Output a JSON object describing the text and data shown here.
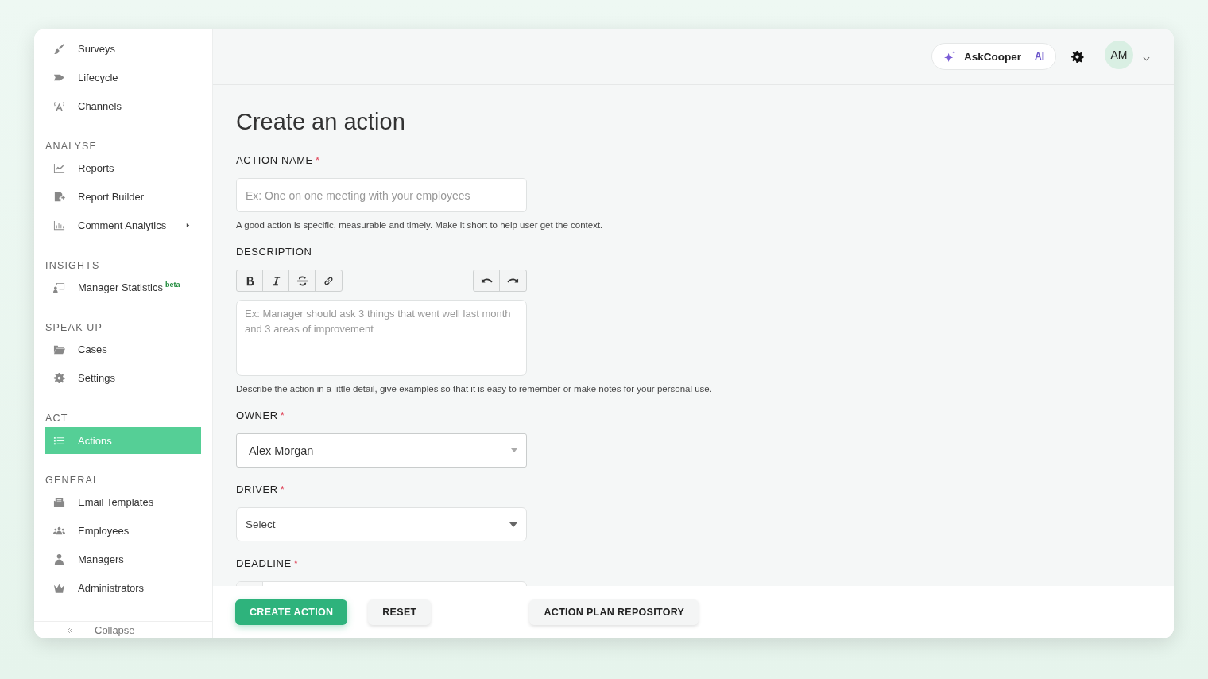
{
  "sidebar": {
    "groups": [
      {
        "items": [
          {
            "label": "Surveys",
            "selected": false
          },
          {
            "label": "Lifecycle",
            "selected": false
          },
          {
            "label": "Channels",
            "selected": false
          }
        ]
      },
      {
        "heading": "ANALYSE",
        "items": [
          {
            "label": "Reports",
            "selected": false
          },
          {
            "label": "Report Builder",
            "selected": false
          },
          {
            "label": "Comment Analytics",
            "selected": false,
            "submenu": true
          }
        ]
      },
      {
        "heading": "INSIGHTS",
        "items": [
          {
            "label": "Manager Statistics",
            "selected": false,
            "badge": "beta"
          }
        ]
      },
      {
        "heading": "SPEAK UP",
        "items": [
          {
            "label": "Cases",
            "selected": false
          },
          {
            "label": "Settings",
            "selected": false
          }
        ]
      },
      {
        "heading": "ACT",
        "items": [
          {
            "label": "Actions",
            "selected": true
          }
        ]
      },
      {
        "heading": "GENERAL",
        "items": [
          {
            "label": "Email Templates",
            "selected": false
          },
          {
            "label": "Employees",
            "selected": false
          },
          {
            "label": "Managers",
            "selected": false
          },
          {
            "label": "Administrators",
            "selected": false
          }
        ]
      }
    ],
    "collapse": "Collapse"
  },
  "header": {
    "assistant": {
      "label": "AskCooper",
      "tag": "AI"
    },
    "avatar": "AM"
  },
  "form": {
    "title": "Create an action",
    "fields": [
      {
        "kind": "text",
        "label": "ACTION NAME",
        "marker": "*",
        "placeholder": "Ex: One on one meeting with your employees",
        "help": "A good action is specific, measurable and timely. Make it short to help user get the context."
      },
      {
        "kind": "editor",
        "label": "DESCRIPTION",
        "placeholder": "Ex: Manager should ask 3 things that went well last month and 3 areas of improvement",
        "help": "Describe the action in a little detail, give examples so that it is easy to remember or make notes for your personal use."
      },
      {
        "kind": "select",
        "label": "OWNER",
        "marker": "*",
        "value": "Alex Morgan"
      },
      {
        "kind": "select",
        "label": "DRIVER",
        "marker": "*",
        "placeholder": "Select"
      },
      {
        "kind": "date",
        "label": "DEADLINE",
        "marker": "*"
      }
    ]
  },
  "actions": [
    {
      "label": "CREATE ACTION",
      "kind": "primary"
    },
    {
      "label": "RESET",
      "kind": "secondary"
    },
    {
      "label": "ACTION PLAN REPOSITORY",
      "kind": "secondary"
    }
  ]
}
